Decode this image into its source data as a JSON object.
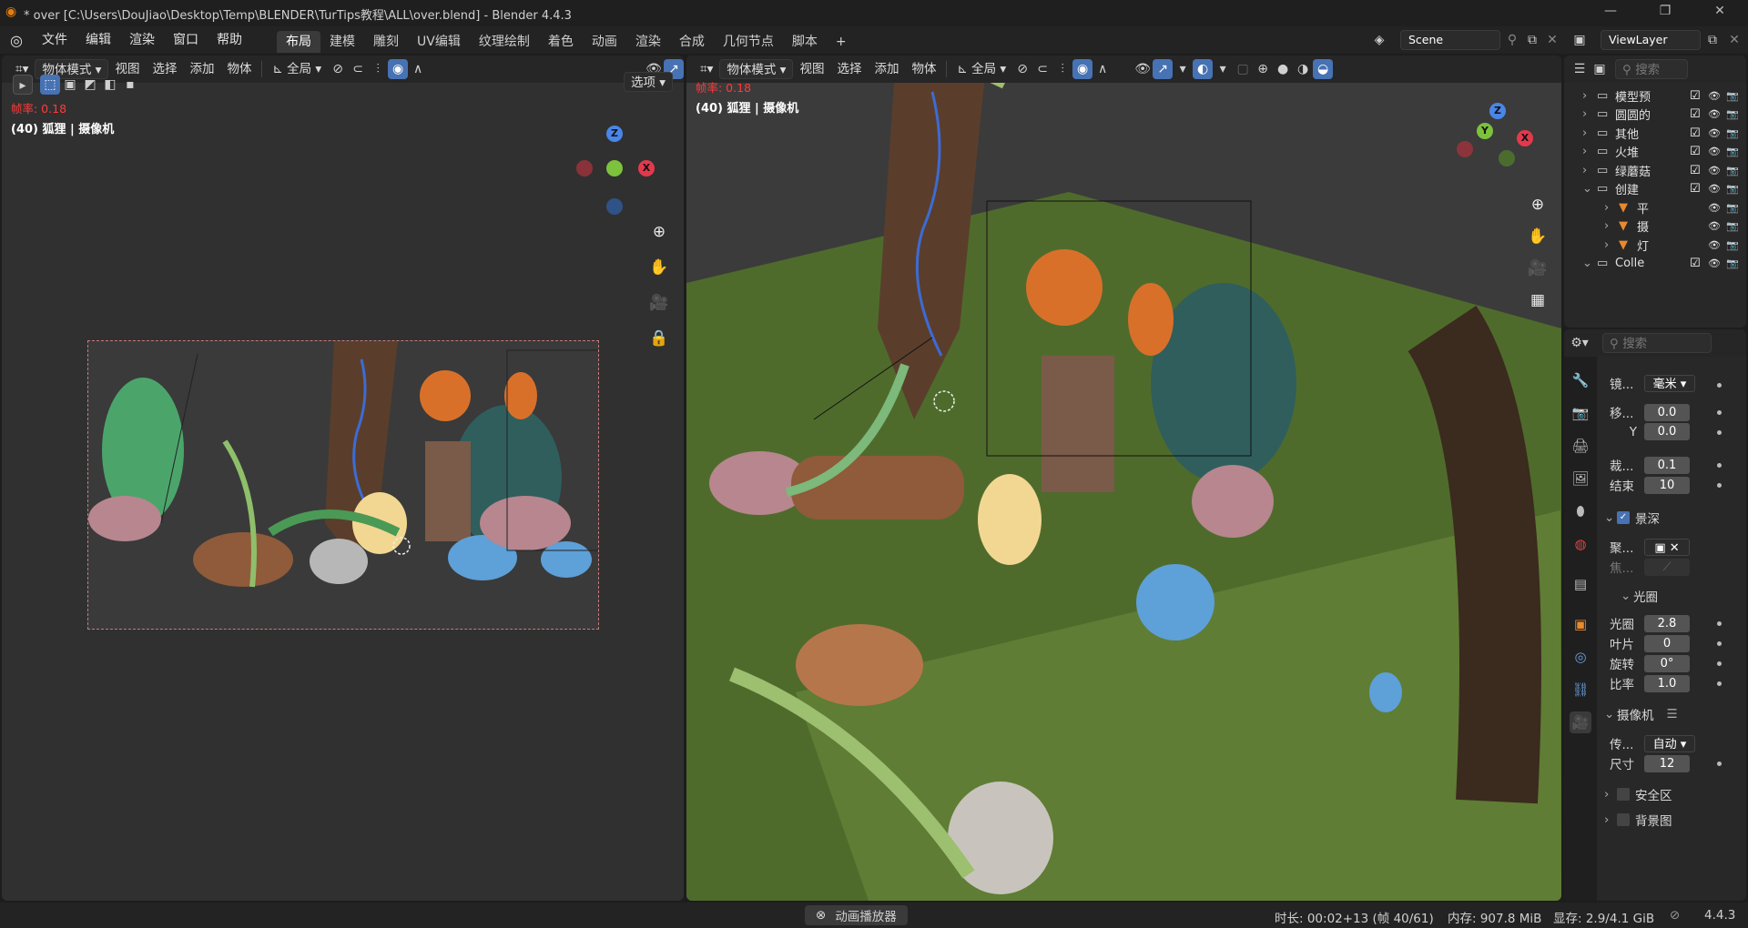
{
  "window": {
    "title": "* over [C:\\Users\\DouJiao\\Desktop\\Temp\\BLENDER\\TurTips教程\\ALL\\over.blend] - Blender 4.4.3"
  },
  "menu": [
    "文件",
    "编辑",
    "渲染",
    "窗口",
    "帮助"
  ],
  "workspaces": [
    "布局",
    "建模",
    "雕刻",
    "UV编辑",
    "纹理绘制",
    "着色",
    "动画",
    "渲染",
    "合成",
    "几何节点",
    "脚本",
    "+"
  ],
  "scene": {
    "name": "Scene",
    "view_layer": "ViewLayer"
  },
  "left_viewport": {
    "mode": "物体模式",
    "menus": [
      "视图",
      "选择",
      "添加",
      "物体"
    ],
    "transform": "全局",
    "options_label": "选项",
    "fps_label": "帧率: 0.18",
    "info": "(40) 狐狸 | 摄像机",
    "gizmo": {
      "z": "Z",
      "x": "X"
    }
  },
  "right_viewport": {
    "mode": "物体模式",
    "menus": [
      "视图",
      "选择",
      "添加",
      "物体"
    ],
    "transform": "全局",
    "fps_label": "帧率: 0.18",
    "info": "(40) 狐狸 | 摄像机",
    "gizmo": {
      "z": "Z",
      "x": "X",
      "y": "Y"
    }
  },
  "outliner": {
    "search_placeholder": "搜索",
    "rows": [
      {
        "label": "模型预",
        "indent": 0
      },
      {
        "label": "圆圆的",
        "indent": 0
      },
      {
        "label": "其他",
        "indent": 0
      },
      {
        "label": "火堆",
        "indent": 0
      },
      {
        "label": "绿蘑菇",
        "indent": 0
      },
      {
        "label": "创建",
        "indent": 0
      },
      {
        "label": "平",
        "indent": 1
      },
      {
        "label": "摄",
        "indent": 1
      },
      {
        "label": "灯",
        "indent": 1
      },
      {
        "label": "Colle",
        "indent": 0
      }
    ]
  },
  "properties": {
    "search_placeholder": "搜索",
    "lens_unit_label": "镜...",
    "lens_unit_value": "毫米",
    "shift_label": "移...",
    "shift_x": "0.0",
    "shift_y_label": "Y",
    "shift_y": "0.0",
    "clip_start_label": "裁...",
    "clip_start": "0.1",
    "clip_end_label": "结束",
    "clip_end": "10",
    "dof_label": "景深",
    "focus_obj_label": "聚...",
    "focus_dist_label": "焦...",
    "aperture_panel": "光圈",
    "fstop_label": "光圈",
    "fstop": "2.8",
    "blades_label": "叶片",
    "blades": "0",
    "rotation_label": "旋转",
    "rotation": "0°",
    "ratio_label": "比率",
    "ratio": "1.0",
    "camera_panel": "摄像机",
    "sensor_label": "传...",
    "sensor_value": "自动",
    "size_label": "尺寸",
    "size_value": "12",
    "safe_areas_label": "安全区",
    "background_label": "背景图"
  },
  "status": {
    "popup": "动画播放器",
    "duration": "时长: 00:02+13 (帧 40/61)",
    "memory": "内存: 907.8 MiB",
    "vram": "显存: 2.9/4.1 GiB",
    "version": "4.4.3"
  }
}
